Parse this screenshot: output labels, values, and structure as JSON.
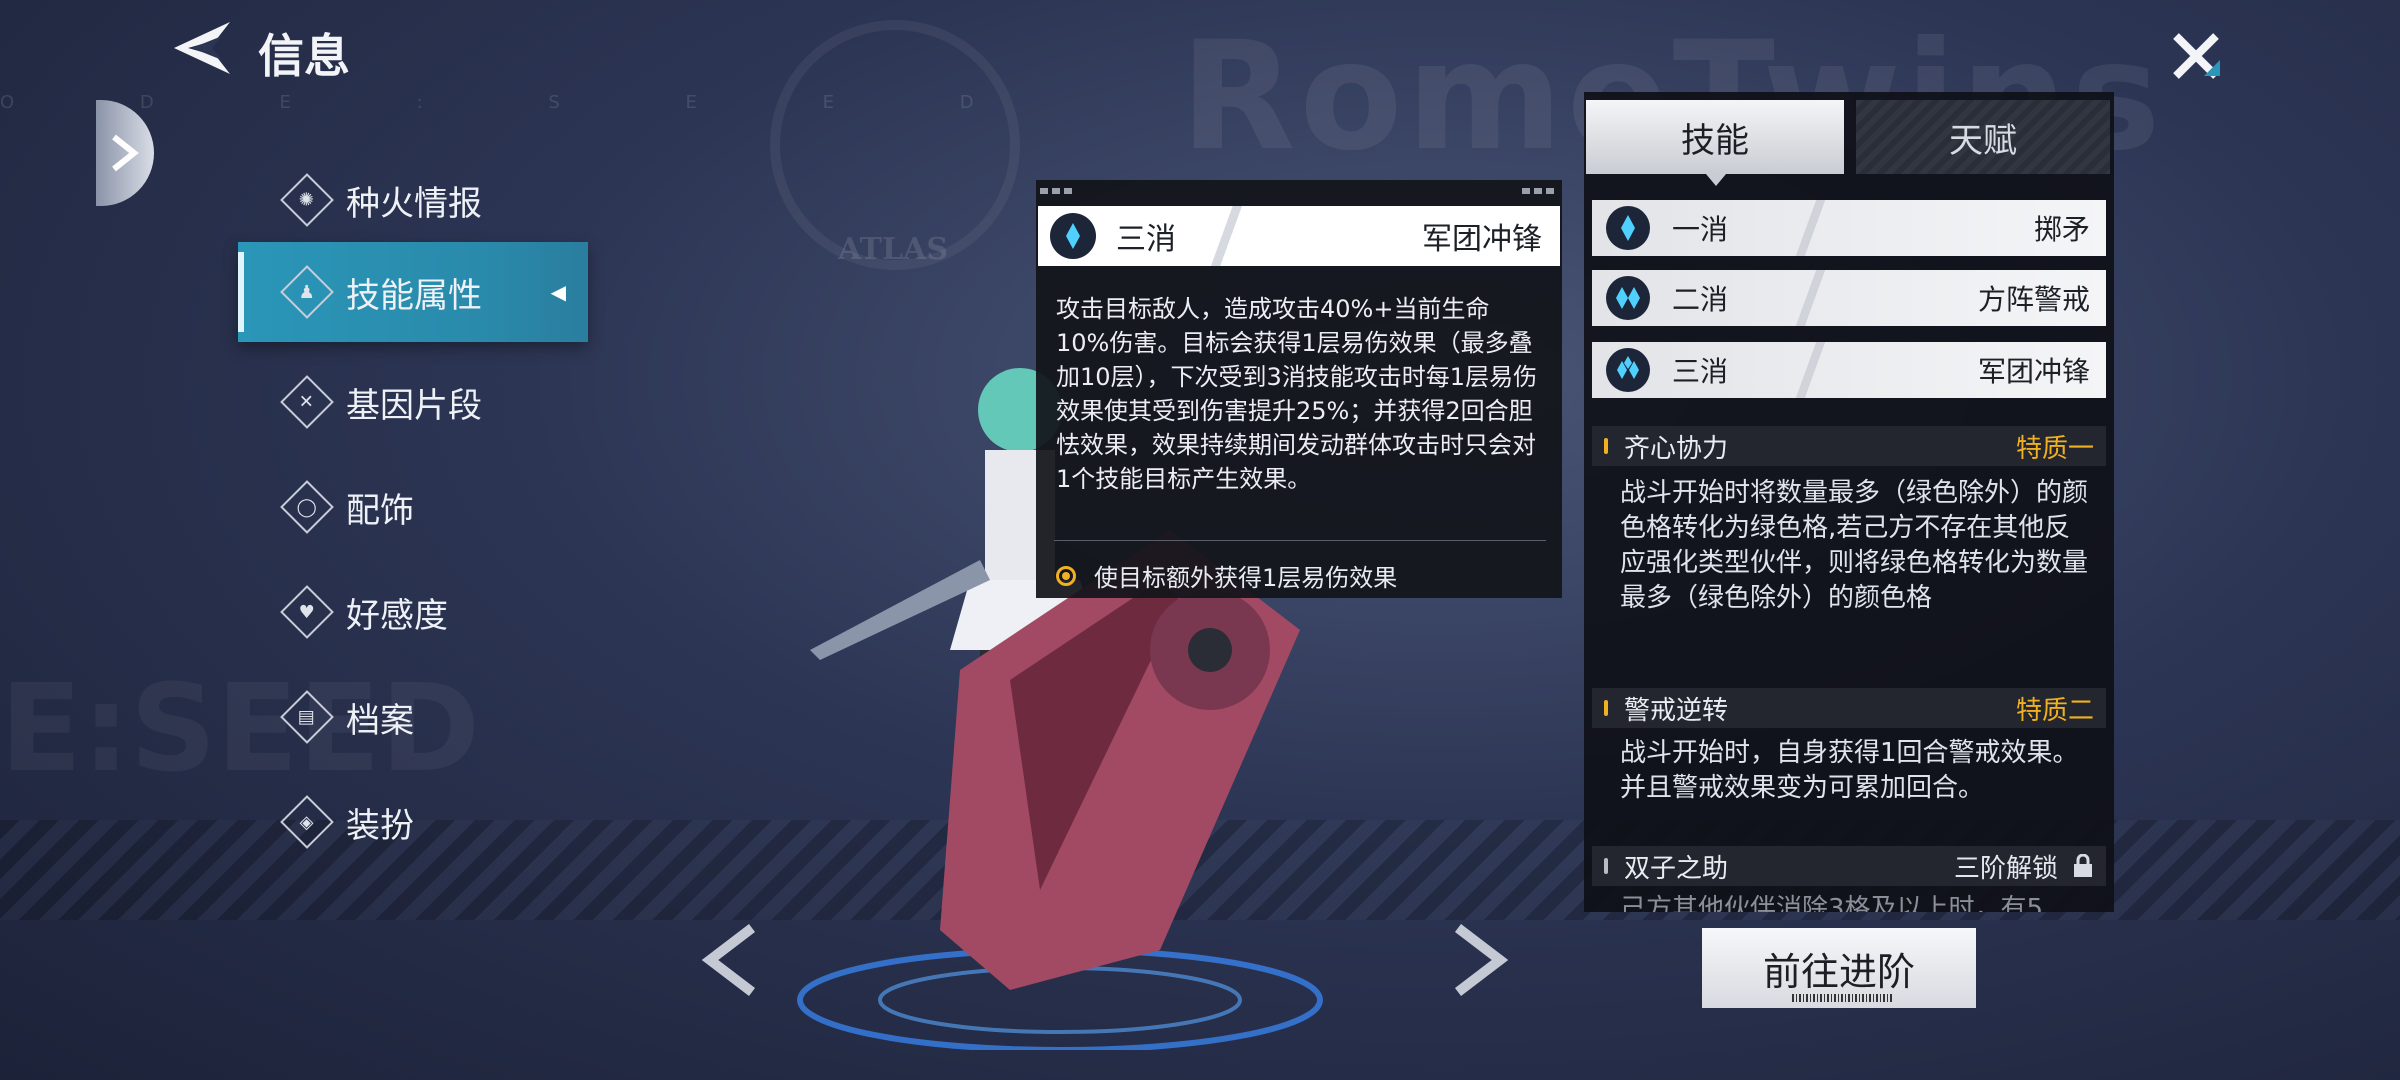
{
  "header": {
    "title": "信息"
  },
  "background": {
    "watermark": "RomeTwins",
    "code": "O D E : S E E D",
    "seed": "E:SEED",
    "emblem_text": "ATLAS"
  },
  "menu": {
    "items": [
      {
        "label": "种火情报",
        "icon": "flame-icon",
        "glyph": "✺"
      },
      {
        "label": "技能属性",
        "icon": "skill-icon",
        "glyph": "♟",
        "active": true
      },
      {
        "label": "基因片段",
        "icon": "gene-icon",
        "glyph": "✕"
      },
      {
        "label": "配饰",
        "icon": "accessory-icon",
        "glyph": "◯"
      },
      {
        "label": "好感度",
        "icon": "heart-icon",
        "glyph": "♥"
      },
      {
        "label": "档案",
        "icon": "file-icon",
        "glyph": "▤"
      },
      {
        "label": "装扮",
        "icon": "outfit-icon",
        "glyph": "◈"
      }
    ]
  },
  "popup": {
    "level": "三消",
    "name": "军团冲锋",
    "description": "攻击目标敌人，造成攻击40%+当前生命10%伤害。目标会获得1层易伤效果（最多叠加10层），下次受到3消技能攻击时每1层易伤效果使其受到伤害提升25%；并获得2回合胆怯效果，效果持续期间发动群体攻击时只会对1个技能目标产生效果。",
    "bullet": "使目标额外获得1层易伤效果"
  },
  "panel": {
    "tabs": [
      {
        "label": "技能"
      },
      {
        "label": "天赋"
      }
    ],
    "skills": [
      {
        "level": "一消",
        "name": "掷矛"
      },
      {
        "level": "二消",
        "name": "方阵警戒"
      },
      {
        "level": "三消",
        "name": "军团冲锋"
      }
    ],
    "traits": [
      {
        "name": "齐心协力",
        "tag": "特质一",
        "body": "战斗开始时将数量最多（绿色除外）的颜色格转化为绿色格,若己方不存在其他反应强化类型伙伴，则将绿色格转化为数量最多（绿色除外）的颜色格"
      },
      {
        "name": "警戒逆转",
        "tag": "特质二",
        "body": "战斗开始时，自身获得1回合警戒效果。并且警戒效果变为可累加回合。"
      },
      {
        "name": "双子之助",
        "tag": "三阶解锁",
        "body": "己方其他伙伴消除3格及以上时，有5"
      }
    ]
  },
  "advance_button": {
    "label": "前往进阶"
  },
  "colors": {
    "accent": "#2a96b8",
    "gold": "#f0b020",
    "panel": "#0e1016"
  }
}
